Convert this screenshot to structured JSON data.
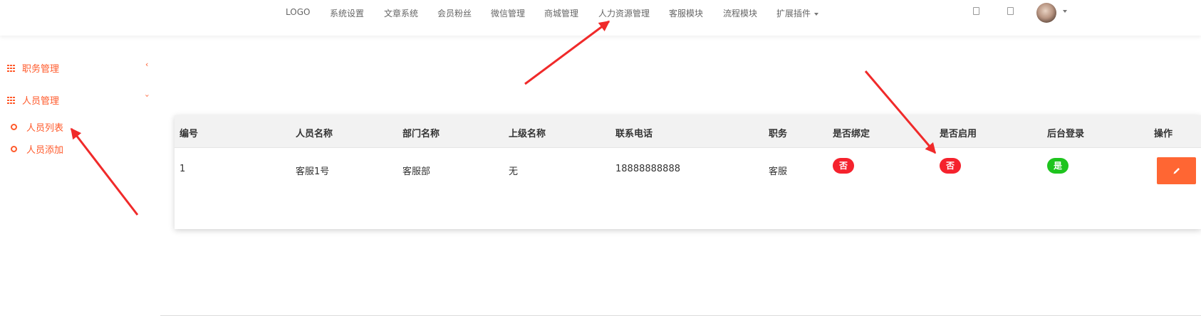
{
  "topnav": {
    "logo": "LOGO",
    "items": [
      "系统设置",
      "文章系统",
      "会员粉丝",
      "微信管理",
      "商城管理",
      "人力资源管理",
      "客服模块",
      "流程模块",
      "扩展插件"
    ]
  },
  "sidebar": {
    "groups": [
      {
        "label": "职务管理",
        "expanded": false
      },
      {
        "label": "人员管理",
        "expanded": true
      }
    ],
    "subitems": [
      "人员列表",
      "人员添加"
    ]
  },
  "table": {
    "headers": [
      "编号",
      "人员名称",
      "部门名称",
      "上级名称",
      "联系电话",
      "职务",
      "是否绑定",
      "是否启用",
      "后台登录",
      "操作"
    ],
    "rows": [
      {
        "id": "1",
        "name": "客服1号",
        "department": "客服部",
        "superior": "无",
        "phone": "18888888888",
        "position": "客服",
        "bound": "否",
        "enabled": "否",
        "backend_login": "是"
      }
    ]
  },
  "colors": {
    "accent": "#ff5a2b",
    "badge_no": "#f5222d",
    "badge_yes": "#1ec41e",
    "edit_button": "#ff6633",
    "annotation_arrow": "#f02a2a"
  }
}
